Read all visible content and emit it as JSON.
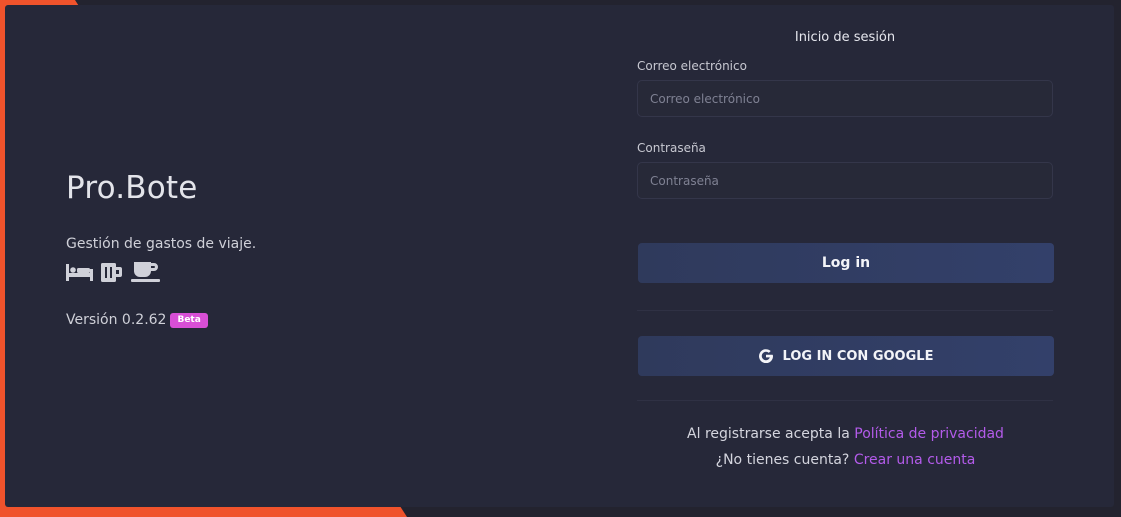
{
  "brand": {
    "name": "Pro.Bote",
    "tagline": "Gestión de gastos de viaje.",
    "icons": [
      "bed-icon",
      "beer-mug-icon",
      "coffee-cup-icon"
    ],
    "version_text": "Versión 0.2.62",
    "badge": "Beta"
  },
  "login": {
    "title": "Inicio de sesión",
    "email_label": "Correo electrónico",
    "email_placeholder": "Correo electrónico",
    "email_value": "",
    "password_label": "Contraseña",
    "password_placeholder": "Contraseña",
    "password_value": "",
    "login_button": "Log in",
    "google_button": "LOG IN CON GOOGLE",
    "google_icon": "google-g-icon"
  },
  "footer": {
    "privacy_prefix": "Al registrarse acepta la",
    "privacy_link": "Política de privacidad",
    "signup_prefix": "¿No tienes cuenta?",
    "signup_link": "Crear una cuenta"
  },
  "colors": {
    "accent_orange": "#f0532c",
    "card_bg": "#262839",
    "link": "#b35bea",
    "badge": "#d84fd6",
    "button": "#33406a"
  }
}
